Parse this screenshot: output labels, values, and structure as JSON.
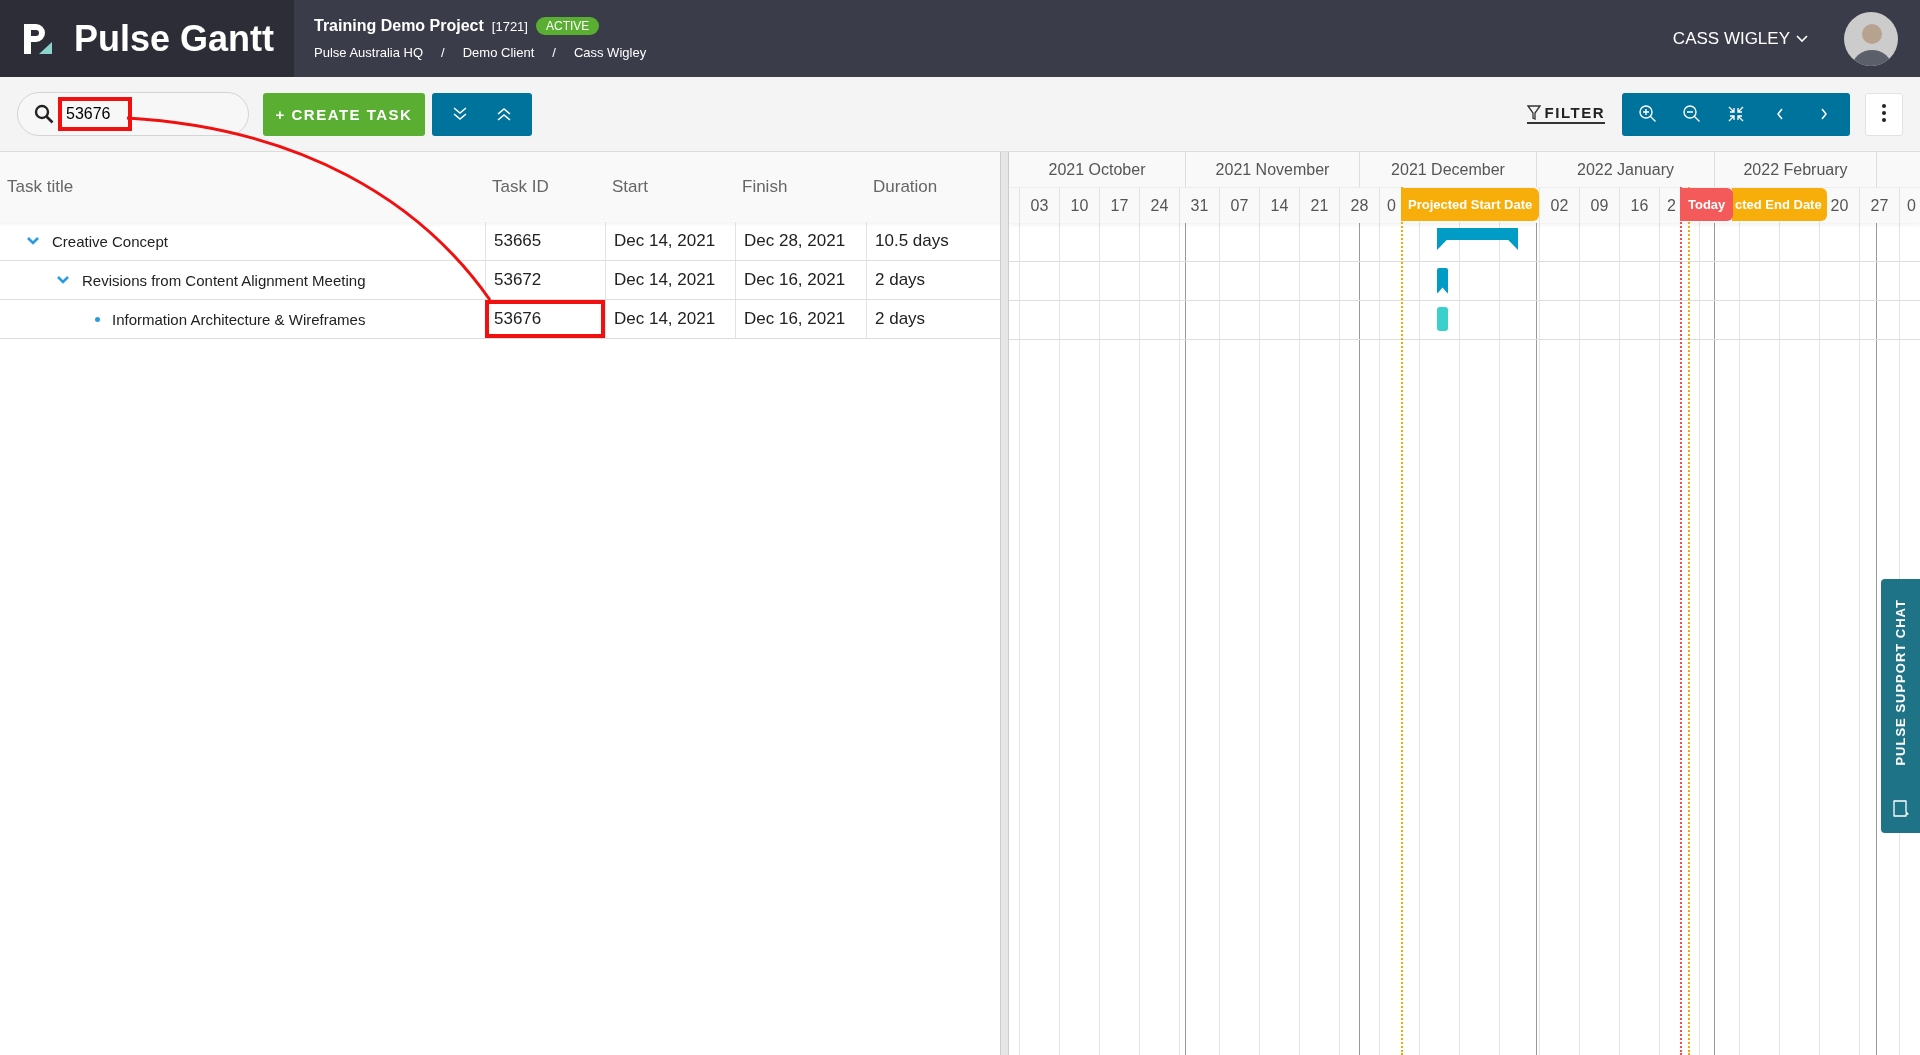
{
  "app": {
    "name": "Pulse Gantt"
  },
  "project": {
    "title": "Training Demo Project",
    "number": "[1721]",
    "status": "ACTIVE",
    "breadcrumb": [
      "Pulse Australia HQ",
      "Demo Client",
      "Cass Wigley"
    ],
    "breadcrumb_separators": [
      "/",
      "/"
    ]
  },
  "user": {
    "name": "CASS WIGLEY"
  },
  "search": {
    "value": "53676",
    "highlighted": true
  },
  "toolbar": {
    "create_label": "+ CREATE TASK",
    "filter_label": "FILTER"
  },
  "table": {
    "columns": [
      "Task title",
      "Task ID",
      "Start",
      "Finish",
      "Duration"
    ],
    "rows": [
      {
        "title": "Creative Concept",
        "id": "53665",
        "start": "Dec 14, 2021",
        "finish": "Dec 28, 2021",
        "duration": "10.5 days",
        "expanded": true,
        "id_highlighted": false,
        "kind": "summary",
        "children": [
          {
            "title": "Revisions from Content Alignment Meeting",
            "id": "53672",
            "start": "Dec 14, 2021",
            "finish": "Dec 16, 2021",
            "duration": "2 days",
            "expanded": true,
            "id_highlighted": false,
            "kind": "task",
            "children": [
              {
                "title": "Information Architecture & Wireframes",
                "id": "53676",
                "start": "Dec 14, 2021",
                "finish": "Dec 16, 2021",
                "duration": "2 days",
                "id_highlighted": true,
                "kind": "leaf"
              }
            ]
          }
        ]
      }
    ]
  },
  "timeline": {
    "months": [
      {
        "label": "2021 October"
      },
      {
        "label": "2021 November"
      },
      {
        "label": "2021 December"
      },
      {
        "label": "2022 January"
      },
      {
        "label": "2022 February"
      }
    ],
    "weeks": [
      {
        "label": "03"
      },
      {
        "label": "10"
      },
      {
        "label": "17"
      },
      {
        "label": "24"
      },
      {
        "label": "31"
      },
      {
        "label": "07"
      },
      {
        "label": "14"
      },
      {
        "label": "21"
      },
      {
        "label": "28"
      },
      {
        "label": "0"
      },
      {
        "label": "02"
      },
      {
        "label": "09"
      },
      {
        "label": "16"
      },
      {
        "label": "2"
      },
      {
        "label": "20"
      },
      {
        "label": "27"
      },
      {
        "label": "0"
      }
    ],
    "markers": [
      {
        "kind": "start",
        "label": "Projected Start Date"
      },
      {
        "kind": "today",
        "label": "Today"
      },
      {
        "kind": "end",
        "label": "cted End Date"
      }
    ]
  },
  "support_chat": {
    "label": "PULSE SUPPORT CHAT"
  }
}
